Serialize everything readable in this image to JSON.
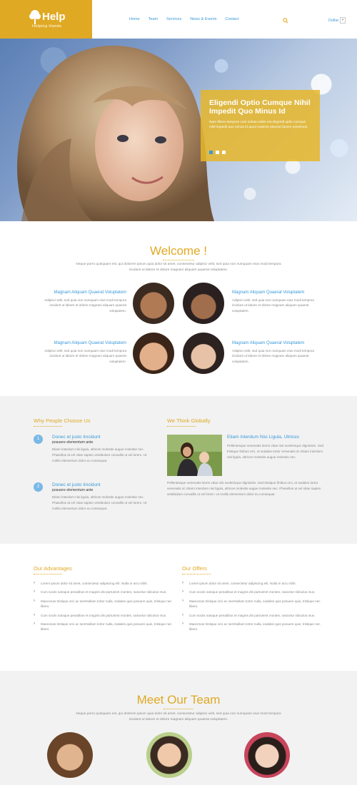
{
  "header": {
    "logo_title": "Help",
    "logo_subtitle": "Helping Hands",
    "nav": [
      "Home",
      "Team",
      "Services",
      "News & Events",
      "Contact"
    ],
    "currency": "Dollar",
    "currency_toggle": "▾"
  },
  "hero": {
    "title": "Eligendi Optio Cumque Nihil Impedit Quo Minus Id",
    "text": "Nam libero tempore cum soluta nobis est eligendi optio cumque nihil impedit quo minus id quod maxime placeat facere possimus."
  },
  "welcome": {
    "title": "Welcome !",
    "intro": "Neque porro quisquam est, qui dolorem ipsum quia dolor sit amet, consectetur adipisci velit, sed quia non numquam eius modi tempora incidunt ut labore et dolore magnam aliquam quaerat voluptatem.",
    "features": [
      {
        "title": "Magnam Aliquam Quaerat Voluptatem",
        "text": "Adipisci velit, sed quia non numquam eius modi tempora incidunt ut labore et dolore magnam aliquam quaerat voluptatem."
      },
      {
        "title": "Magnam Aliquam Quaerat Voluptatem",
        "text": "Adipisci velit, sed quia non numquam eius modi tempora incidunt ut labore et dolore magnam aliquam quaerat voluptatem."
      },
      {
        "title": "Magnam Aliquam Quaerat Voluptatem",
        "text": "Adipisci velit, sed quia non numquam eius modi tempora incidunt ut labore et dolore magnam aliquam quaerat voluptatem."
      },
      {
        "title": "Magnam Aliquam Quaerat Voluptatem",
        "text": "Adipisci velit, sed quia non numquam eius modi tempora incidunt ut labore et dolore magnam aliquam quaerat voluptatem."
      }
    ]
  },
  "why": {
    "title": "Why People Choose Us",
    "items": [
      {
        "num": "1",
        "title": "Donec et justo tincidunt",
        "subtitle": "posuere elementum ante",
        "text": "Etiam interdum nisi ligula, ultrices molestie augue molestie nec. Phasellus at vel vitae sapien vestibulum convallis ut vel lorem. Ut mollis elementum dolor eu consequat."
      },
      {
        "num": "2",
        "title": "Donec et justo tincidunt",
        "subtitle": "posuere elementum ante",
        "text": "Etiam interdum nisi ligula, ultrices molestie augue molestie nec. Phasellus at vel vitae sapien vestibulum convallis ut vel lorem. Ut mollis elementum dolor eu consequat."
      }
    ]
  },
  "global": {
    "title": "We Think Globally",
    "heading": "Etiam Interdum Nisi Ligula, Ultrices",
    "text": "Pellentesque venenatis lorem vitae nisi scelerisque dignissim. Sed tristique finibus orci, et sodales tortor venenatis id. Etiam interdum nisi ligula, ultrices molestie augue molestie nec.",
    "text2": "Pellentesque venenatis lorem vitae nisi scelerisque dignissim. Sed tristique finibus orci, et sodales tortor venenatis id. Etiam interdum nisi ligula, ultrices molestie augue molestie nec. Phasellus at vel vitae sapien vestibulum convallis ut vel lorem. Ut mollis elementum dolor eu consequat."
  },
  "advantages": {
    "title": "Our Advantages",
    "items": [
      "Lorem ipsum dolor sit amet, consectetur adipiscing elit. Nulla in arcu nibh.",
      "Cum sociis natoque penatibus et magnis dis parturient montes, nascetur ridiculus mus.",
      "Maecenas tristique orci ac semNullam tortor nulla, sodales quis posuere quis, tristique nec libero.",
      "Cum sociis natoque penatibus et magnis dis parturient montes, nascetur ridiculus mus.",
      "Maecenas tristique orci ac semNullam tortor nulla, sodales quis posuere quis, tristique nec libero."
    ]
  },
  "offers": {
    "title": "Our Offers",
    "items": [
      "Lorem ipsum dolor sit amet, consectetur adipiscing elit. Nulla in arcu nibh.",
      "Cum sociis natoque penatibus et magnis dis parturient montes, nascetur ridiculus mus.",
      "Maecenas tristique orci ac semNullam tortor nulla, sodales quis posuere quis, tristique nec libero.",
      "Cum sociis natoque penatibus et magnis dis parturient montes, nascetur ridiculus mus.",
      "Maecenas tristique orci ac semNullam tortor nulla, sodales quis posuere quis, tristique nec libero."
    ]
  },
  "team": {
    "title": "Meet Our Team",
    "intro": "Neque porro quisquam est, qui dolorem ipsum quia dolor sit amet, consectetur adipisci velit, sed quia non numquam eius modi tempora incidunt ut labore et dolore magnam aliquam quaerat voluptatem."
  },
  "colors": {
    "accent": "#e0a923",
    "link": "#3a9ad9",
    "band": "#f2f2f2"
  }
}
